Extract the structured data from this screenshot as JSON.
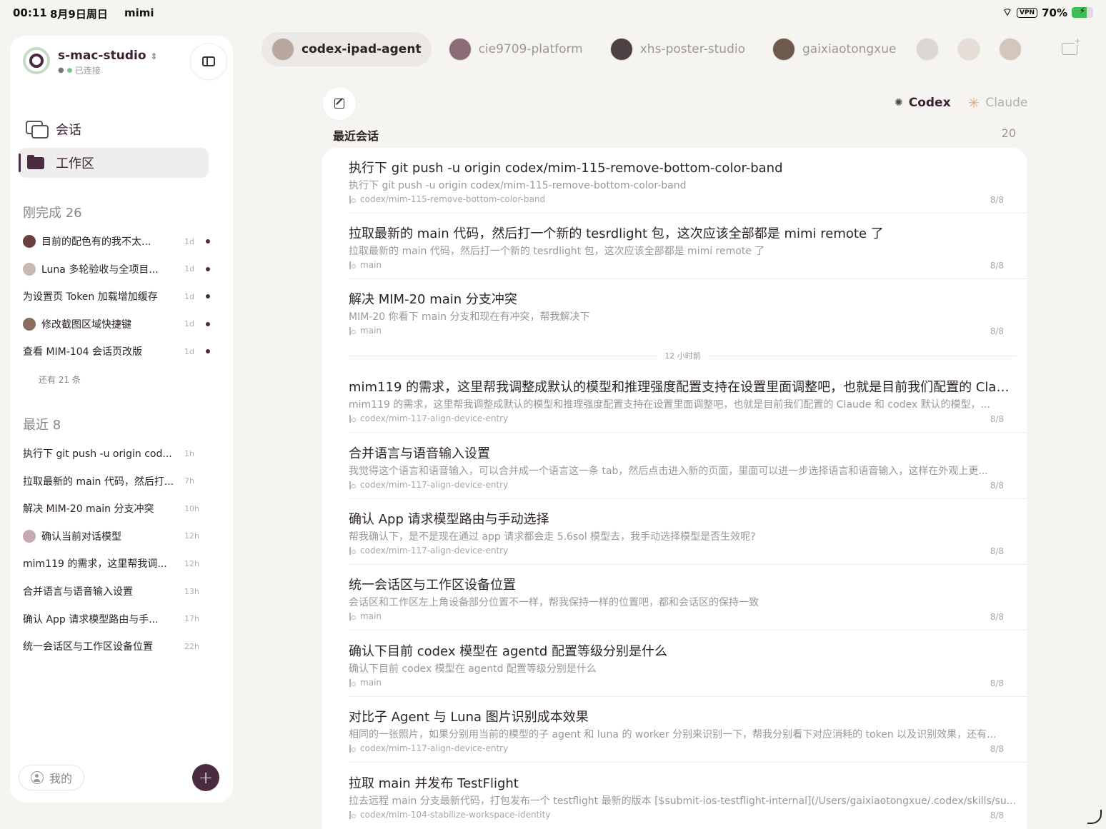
{
  "statusbar": {
    "time": "00:11",
    "date": "8月9日周日",
    "app": "mimi",
    "vpn": "VPN",
    "battery": "70%",
    "battery_level": 0.7
  },
  "sidebar": {
    "device_name": "s-mac-studio",
    "device_status": "已连接",
    "nav": [
      {
        "label": "会话",
        "icon": "chat-icon"
      },
      {
        "label": "工作区",
        "icon": "folder-icon",
        "active": true
      }
    ],
    "completed": {
      "title": "刚完成 26",
      "items": [
        {
          "label": "目前的配色有的我不太...",
          "age": "1d",
          "avatar_color": "#6b3f3f"
        },
        {
          "label": "Luna 多轮验收与全项目...",
          "age": "1d",
          "avatar_color": "#c9b9b0"
        },
        {
          "label": "为设置页 Token 加载增加缓存",
          "age": "1d"
        },
        {
          "label": "修改截图区域快捷键",
          "age": "1d",
          "avatar_color": "#8a6e5e"
        },
        {
          "label": "查看 MIM-104 会话页改版",
          "age": "1d"
        }
      ],
      "more": "还有 21 条"
    },
    "recent": {
      "title": "最近 8",
      "items": [
        {
          "label": "执行下 git push -u origin cod...",
          "age": "1h"
        },
        {
          "label": "拉取最新的 main 代码，然后打...",
          "age": "7h"
        },
        {
          "label": "解决 MIM-20 main 分支冲突",
          "age": "10h"
        },
        {
          "label": "确认当前对话模型",
          "age": "12h",
          "avatar_color": "#c9a9b0"
        },
        {
          "label": "mim119 的需求，这里帮我调...",
          "age": "12h"
        },
        {
          "label": "合并语言与语音输入设置",
          "age": "13h"
        },
        {
          "label": "确认 App 请求模型路由与手...",
          "age": "17h"
        },
        {
          "label": "统一会话区与工作区设备位置",
          "age": "22h"
        }
      ]
    },
    "me_label": "我的",
    "add_label": "+"
  },
  "agents": [
    {
      "name": "codex-ipad-agent",
      "active": true,
      "avatar_color": "#b7a79c"
    },
    {
      "name": "cie9709-platform",
      "avatar_color": "#8d6c78"
    },
    {
      "name": "xhs-poster-studio",
      "avatar_color": "#4e4144"
    },
    {
      "name": "gaixiaotongxue",
      "avatar_color": "#6d5a4c"
    }
  ],
  "extra_agents": [
    {
      "avatar_color": "#c9c1bb"
    },
    {
      "avatar_color": "#d8cbc0"
    },
    {
      "avatar_color": "#b7a290"
    }
  ],
  "models": {
    "active": "Codex",
    "inactive": "Claude"
  },
  "recent_sessions": {
    "title": "最近会话",
    "count": "20",
    "time_separator": "12 小时前",
    "items": [
      {
        "title": "执行下 git push -u origin codex/mim-115-remove-bottom-color-band",
        "preview": "执行下 git push -u origin codex/mim-115-remove-bottom-color-band",
        "branch": "codex/mim-115-remove-bottom-color-band",
        "date": "8/8"
      },
      {
        "title": "拉取最新的 main 代码，然后打一个新的 tesrdlight 包，这次应该全部都是 mimi remote 了",
        "preview": "拉取最新的 main 代码，然后打一个新的 tesrdlight 包，这次应该全部都是 mimi remote 了",
        "branch": "main",
        "date": "8/8"
      },
      {
        "title": "解决 MIM-20 main 分支冲突",
        "preview": "MIM-20 你看下 main 分支和现在有冲突，帮我解决下",
        "branch": "main",
        "date": "8/8"
      },
      {
        "title": "mim119 的需求，这里帮我调整成默认的模型和推理强度配置支持在设置里面调整吧，也就是目前我们配置的 Clau...",
        "preview": "mim119 的需求，这里帮我调整成默认的模型和推理强度配置支持在设置里面调整吧，也就是目前我们配置的 Claude 和 codex 默认的模型，...",
        "branch": "codex/mim-117-align-device-entry",
        "date": "8/8"
      },
      {
        "title": "合并语言与语音输入设置",
        "preview": "我觉得这个语言和语音输入，可以合并成一个语言这一条 tab，然后点击进入新的页面，里面可以进一步选择语言和语音输入，这样在外观上更...",
        "branch": "codex/mim-117-align-device-entry",
        "date": "8/8"
      },
      {
        "title": "确认 App 请求模型路由与手动选择",
        "preview": "帮我确认下，是不是现在通过 app 请求都会走 5.6sol 模型去，我手动选择模型是否生效呢?",
        "branch": "codex/mim-117-align-device-entry",
        "date": "8/8"
      },
      {
        "title": "统一会话区与工作区设备位置",
        "preview": "会话区和工作区左上角设备部分位置不一样，帮我保持一样的位置吧，都和会话区的保持一致",
        "branch": "main",
        "date": "8/8"
      },
      {
        "title": "确认下目前 codex 模型在 agentd 配置等级分别是什么",
        "preview": "确认下目前 codex 模型在 agentd 配置等级分别是什么",
        "branch": "main",
        "date": "8/8"
      },
      {
        "title": "对比子 Agent 与 Luna 图片识别成本效果",
        "preview": "相同的一张照片，如果分别用当前的模型的子 agent 和 luna 的 worker 分别来识别一下，帮我分别看下对应消耗的 token 以及识别效果，还有...",
        "branch": "codex/mim-117-align-device-entry",
        "date": "8/8"
      },
      {
        "title": "拉取 main 并发布 TestFlight",
        "preview": "拉去远程 main 分支最新代码，打包发布一个 testflight 最新的版本 [$submit-ios-testflight-internal](/Users/gaixiaotongxue/.codex/skills/su...",
        "branch": "codex/mim-104-stabilize-workspace-identity",
        "date": "8/8"
      }
    ]
  }
}
